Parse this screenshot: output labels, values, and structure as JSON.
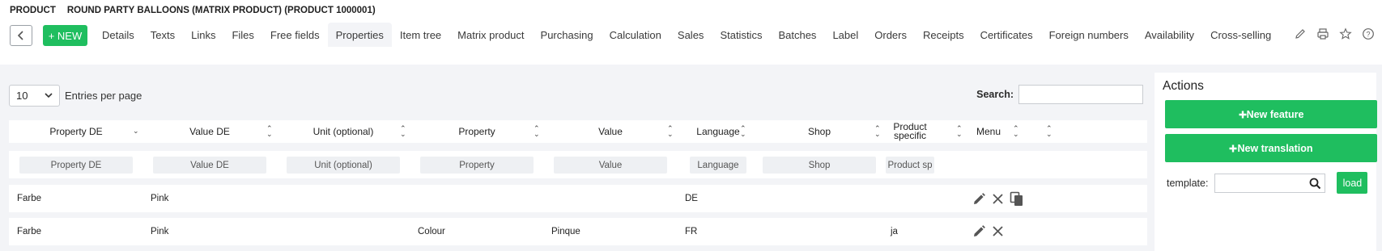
{
  "header": {
    "type_label": "PRODUCT",
    "title": "ROUND PARTY BALLOONS (MATRIX PRODUCT) (PRODUCT 1000001)",
    "new_label": "+ NEW",
    "tabs": [
      "Details",
      "Texts",
      "Links",
      "Files",
      "Free fields",
      "Properties",
      "Item tree",
      "Matrix product",
      "Purchasing",
      "Calculation",
      "Sales",
      "Statistics",
      "Batches",
      "Label",
      "Orders",
      "Receipts",
      "Certificates",
      "Foreign numbers",
      "Availability",
      "Cross-selling"
    ],
    "active_tab": "Properties",
    "tool_icons": [
      "pencil-icon",
      "printer-icon",
      "star-icon",
      "help-icon"
    ]
  },
  "list": {
    "entries_value": "10",
    "entries_label": "Entries per page",
    "search_label": "Search:",
    "search_value": ""
  },
  "table": {
    "columns": [
      "Property DE",
      "Value DE",
      "Unit (optional)",
      "Property",
      "Value",
      "Language",
      "Shop",
      "Product specific",
      "Menu"
    ],
    "filters": [
      "Property DE",
      "Value DE",
      "Unit (optional)",
      "Property",
      "Value",
      "Language",
      "Shop",
      "Product sp"
    ],
    "rows": [
      {
        "property_de": "Farbe",
        "value_de": "Pink",
        "unit": "",
        "property": "",
        "value": "",
        "language": "DE",
        "shop": "",
        "product_specific": ""
      },
      {
        "property_de": "Farbe",
        "value_de": "Pink",
        "unit": "",
        "property": "Colour",
        "value": "Pinque",
        "language": "FR",
        "shop": "",
        "product_specific": "ja"
      }
    ]
  },
  "actions": {
    "title": "Actions",
    "new_feature": "New feature",
    "new_translation": "New translation",
    "template_label": "template:",
    "template_value": "",
    "load_label": "load"
  },
  "colors": {
    "accent": "#1fbe5f",
    "background": "#f3f4f7"
  }
}
